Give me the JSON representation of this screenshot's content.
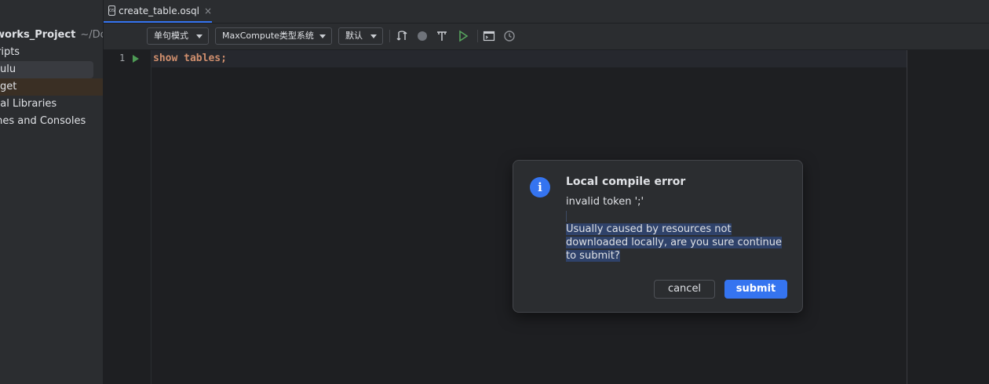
{
  "sidebar": {
    "project_name": "works_Project",
    "project_path": "~/Docu",
    "items": [
      {
        "label": "ripts"
      },
      {
        "label": "ulu"
      },
      {
        "label": "get"
      },
      {
        "label": "nal Libraries"
      },
      {
        "label": "ches and Consoles"
      }
    ]
  },
  "tab": {
    "file_icon_text": "OSQL",
    "label": "create_table.osql",
    "close_glyph": "×"
  },
  "toolbar": {
    "mode": "单句模式",
    "type_system": "MaxCompute类型系统",
    "default": "默认",
    "icons": [
      "refresh-icon",
      "stop-icon",
      "format-icon",
      "run-icon",
      "sql-console-icon",
      "history-icon"
    ]
  },
  "editor": {
    "line_number": "1",
    "code_keyword": "show tables",
    "code_semicolon": ";"
  },
  "dialog": {
    "title": "Local compile error",
    "token_message": "invalid token ';'",
    "message_lines": [
      "Usually caused by resources not",
      "downloaded locally, are you sure continue",
      "to submit?"
    ],
    "cancel_label": "cancel",
    "submit_label": "submit",
    "icon_glyph": "i"
  },
  "colors": {
    "accent": "#3574f0",
    "keyword": "#cf8e6d",
    "run_green": "#4e9a55"
  }
}
